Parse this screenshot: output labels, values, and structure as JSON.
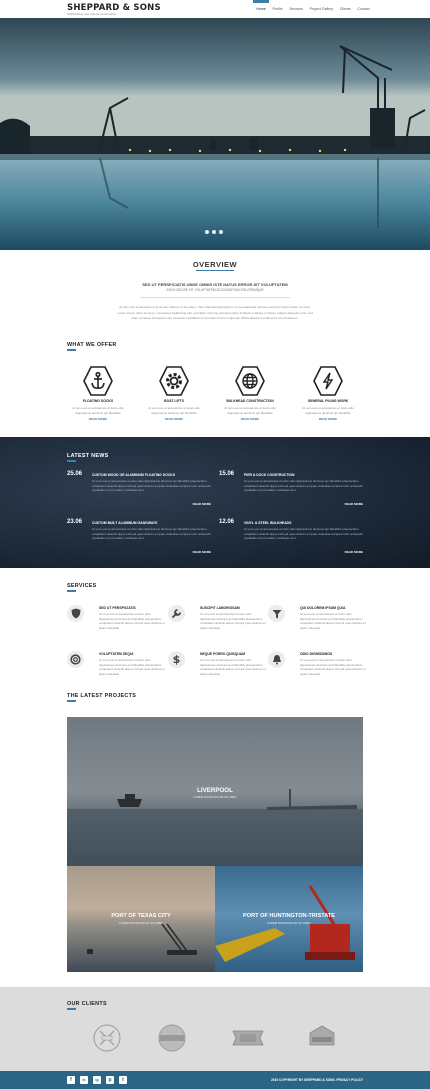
{
  "header": {
    "logo": "SHEPPARD & SONS",
    "tagline": "Shipbuilding and marine construction",
    "nav": [
      "Home",
      "Profile",
      "Services",
      "Project Gallery",
      "Clients",
      "Contact"
    ],
    "active_nav": "Home"
  },
  "hero": {
    "slides": 3
  },
  "overview": {
    "title": "OVERVIEW",
    "subtitle": "SED UT PERSPICIATIS UNDE OMNIS ISTE NATUS ERROR SIT VOLUPTATEM",
    "subtitle2": "ATUS ODIOSE SIT VOLUPTATEM ACCUSANTIUM DOLOREMQUE",
    "body": "At vero eos et accusam et justo duo dolores et ea rebum. Stet clita kasd gubergren, no sea takimata sanctus est lorem ipsum dolor sit amet. Lorem ipsum dolor sit amet, consetetur sadipscing elitr, sed diam nonumy eirmod tempor invidunt ut labore et dolore magna aliquyam erat, sed diam voluptua. Excepteur sint occaecat cupidatat non proident sunt in culpa qui officia deserunt mollit anim id est laborum."
  },
  "offer": {
    "title": "WHAT WE OFFER",
    "items": [
      {
        "icon": "anchor-icon",
        "title": "FLOATING DOCKS",
        "text": "At vero eos et accusamus et iusto odio dignissimos ducimus qui blanditiis",
        "more": "READ MORE"
      },
      {
        "icon": "gear-icon",
        "title": "BOAT LIFTS",
        "text": "At vero eos et accusamus et iusto odio dignissimos ducimus qui blanditiis",
        "more": "READ MORE"
      },
      {
        "icon": "globe-icon",
        "title": "BULKHEAD CONSTRUCTION",
        "text": "At vero eos et accusamus et iusto odio dignissimos ducimus qui blanditiis",
        "more": "READ MORE"
      },
      {
        "icon": "lightning-icon",
        "title": "GENERAL PILING WORK",
        "text": "At vero eos et accusamus et iusto odio dignissimos ducimus qui blanditiis",
        "more": "READ MORE"
      }
    ]
  },
  "news": {
    "title": "LATEST NEWS",
    "items": [
      {
        "date": "25.06",
        "title": "CUSTOM WOOD OR ALUMINUM FLOATING DOCKS",
        "text": "At vero eos et accusamus et iusto odio dignissimos ducimus qui blanditiis praesentium voluptatum deleniti atque corrupti quos dolores et quas molestias excepturi sint occaecati cupiditate non provident, similique sunt",
        "more": "READ MORE"
      },
      {
        "date": "15.06",
        "title": "PIER & DOCK CONSTRUCTION",
        "text": "At vero eos et accusamus et iusto odio dignissimos ducimus qui blanditiis praesentium voluptatum deleniti atque corrupti quos dolores et quas molestias excepturi sint occaecati cupiditate non provident, similique sunt",
        "more": "READ MORE"
      },
      {
        "date": "23.06",
        "title": "CUSTOM BUILT ALUMINUM GANGWAYS",
        "text": "At vero eos et accusamus et iusto odio dignissimos ducimus qui blanditiis praesentium voluptatum deleniti atque corrupti quos dolores et quas molestias excepturi sint occaecati cupiditate non provident, similique sunt",
        "more": "READ MORE"
      },
      {
        "date": "12.06",
        "title": "VINYL & STEEL BULKHEADS",
        "text": "At vero eos et accusamus et iusto odio dignissimos ducimus qui blanditiis praesentium voluptatum deleniti atque corrupti quos dolores et quas molestias excepturi sint occaecati cupiditate non provident, similique sunt",
        "more": "READ MORE"
      }
    ]
  },
  "services": {
    "title": "SERVICES",
    "items": [
      {
        "icon": "shield-icon",
        "title": "SED UT PERSPICIATIS",
        "text": "At vero eos et accusamus et iusto odio dignissimos ducimus qui blanditiis praesentium voluptatum deleniti atque corrupti quos dolores et quas molestias"
      },
      {
        "icon": "wrench-icon",
        "title": "SUSCIPIT LABORIOSAM",
        "text": "At vero eos et accusamus et iusto odio dignissimos ducimus qui blanditiis praesentium voluptatum deleniti atque corrupti quos dolores et quas molestias"
      },
      {
        "icon": "filter-icon",
        "title": "QUI DOLOREM IPSUM QUIA",
        "text": "At vero eos et accusamus et iusto odio dignissimos ducimus qui blanditiis praesentium voluptatum deleniti atque corrupti quos dolores et quas molestias"
      },
      {
        "icon": "lifebuoy-icon",
        "title": "VOLUPTATEM SEQUI",
        "text": "At vero eos et accusamus et iusto odio dignissimos ducimus qui blanditiis praesentium voluptatum deleniti atque corrupti quos dolores et quas molestias"
      },
      {
        "icon": "dollar-icon",
        "title": "NEQUE PORRO QUISQUAM",
        "text": "At vero eos et accusamus et iusto odio dignissimos ducimus qui blanditiis praesentium voluptatum deleniti atque corrupti quos dolores et quas molestias"
      },
      {
        "icon": "bell-icon",
        "title": "ODIO DIGNISSIMOS",
        "text": "At vero eos et accusamus et iusto odio dignissimos ducimus qui blanditiis praesentium voluptatum deleniti atque corrupti quos dolores et quas molestias"
      }
    ]
  },
  "projects": {
    "title": "THE LATEST PROJECTS",
    "items": [
      {
        "name": "LIVERPOOL",
        "sub": "LOREM IPSUM DOLOR SIT AMET"
      },
      {
        "name": "PORT OF TEXAS CITY",
        "sub": "LOREM IPSUM DOLOR SIT AMET"
      },
      {
        "name": "PORT OF HUNTINGTON-TRISTATE",
        "sub": "LOREM IPSUM DOLOR SIT AMET"
      }
    ]
  },
  "clients": {
    "title": "OUR CLIENTS"
  },
  "footer": {
    "social": [
      "f",
      "in",
      "ig",
      "p",
      "t"
    ],
    "copyright": "2015 COPYRIGHT BY SHEPPARD & SONS. PRIVACY POLICY"
  },
  "colors": {
    "accent": "#3f7da6",
    "footer": "#2b6585",
    "news_bg": "#1e2b3b"
  }
}
